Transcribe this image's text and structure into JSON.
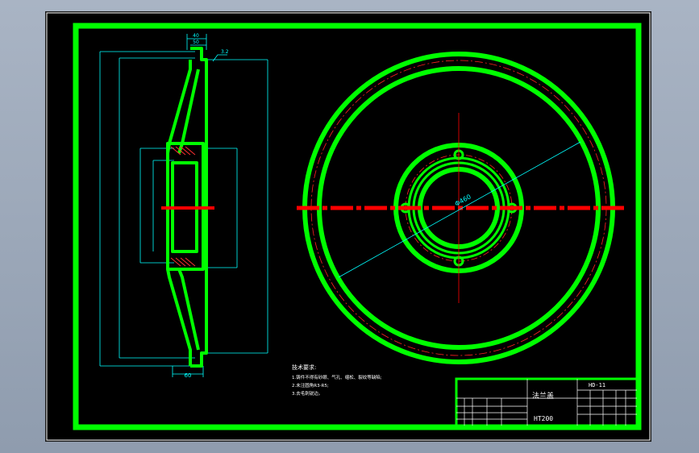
{
  "drawing": {
    "part_name": "法兰盖",
    "material": "HT200",
    "drawing_number": "HD-11",
    "technical_requirements": {
      "heading": "技术要求:",
      "lines": [
        "1.铸件不得有砂眼、气孔、缩松、裂纹等缺陷;",
        "2.未注圆角R3-R5;",
        "3.去毛刺锐边。"
      ]
    }
  },
  "dimensions": {
    "top_width": "40",
    "top_hub": "50",
    "bottom_width": "60",
    "bolt_circle": "Φ460",
    "roughness": "3.2"
  },
  "colors": {
    "background": "#000000",
    "outline": "#00ff00",
    "dimension": "#00ffff",
    "center_line": "#ff0000",
    "text": "#ffffff"
  }
}
